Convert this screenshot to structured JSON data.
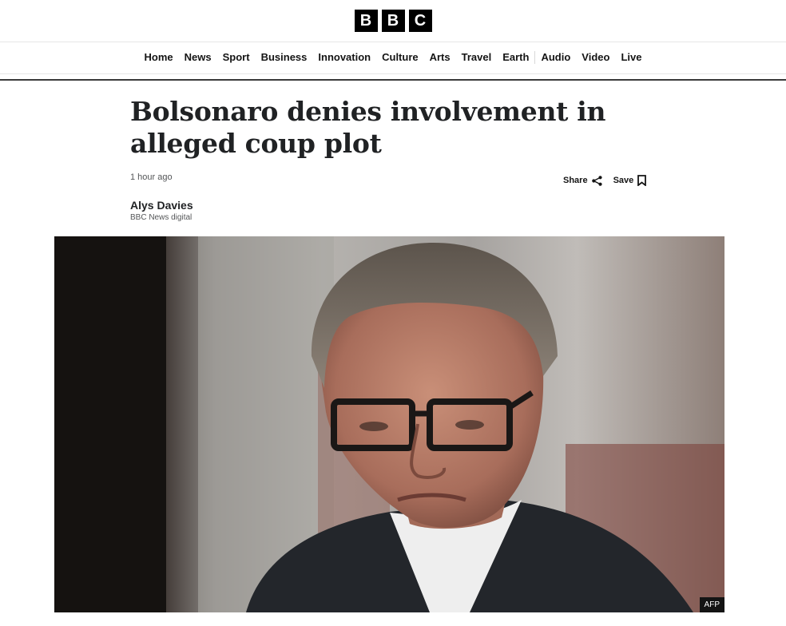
{
  "brand": {
    "letters": [
      "B",
      "B",
      "C"
    ]
  },
  "nav": {
    "items": [
      "Home",
      "News",
      "Sport",
      "Business",
      "Innovation",
      "Culture",
      "Arts",
      "Travel",
      "Earth",
      "Audio",
      "Video",
      "Live"
    ]
  },
  "article": {
    "headline": "Bolsonaro denies involvement in alleged coup plot",
    "timestamp": "1 hour ago",
    "share_label": "Share",
    "save_label": "Save",
    "author_name": "Alys Davies",
    "author_role": "BBC News digital",
    "image_credit": "AFP"
  },
  "icons": {
    "share": "share-icon",
    "save": "bookmark-icon"
  }
}
